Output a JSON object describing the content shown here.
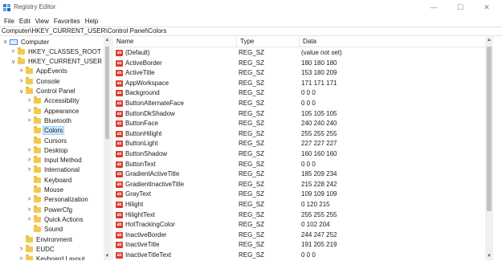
{
  "window": {
    "title": "Registry Editor",
    "min_glyph": "—",
    "max_glyph": "☐",
    "close_glyph": "✕"
  },
  "menu": [
    "File",
    "Edit",
    "View",
    "Favorites",
    "Help"
  ],
  "address": "Computer\\HKEY_CURRENT_USER\\Control Panel\\Colors",
  "tree": [
    {
      "label": "Computer",
      "level": 0,
      "chevron": "∨",
      "kind": "computer"
    },
    {
      "label": "HKEY_CLASSES_ROOT",
      "level": 1,
      "chevron": ">",
      "kind": "folder"
    },
    {
      "label": "HKEY_CURRENT_USER",
      "level": 1,
      "chevron": "∨",
      "kind": "folder"
    },
    {
      "label": "AppEvents",
      "level": 2,
      "chevron": ">",
      "kind": "folder"
    },
    {
      "label": "Console",
      "level": 2,
      "chevron": ">",
      "kind": "folder"
    },
    {
      "label": "Control Panel",
      "level": 2,
      "chevron": "∨",
      "kind": "folder"
    },
    {
      "label": "Accessibility",
      "level": 3,
      "chevron": ">",
      "kind": "folder"
    },
    {
      "label": "Appearance",
      "level": 3,
      "chevron": ">",
      "kind": "folder"
    },
    {
      "label": "Bluetooth",
      "level": 3,
      "chevron": ">",
      "kind": "folder"
    },
    {
      "label": "Colors",
      "level": 3,
      "chevron": "",
      "kind": "folder",
      "selected": true
    },
    {
      "label": "Cursors",
      "level": 3,
      "chevron": "",
      "kind": "folder"
    },
    {
      "label": "Desktop",
      "level": 3,
      "chevron": ">",
      "kind": "folder"
    },
    {
      "label": "Input Method",
      "level": 3,
      "chevron": ">",
      "kind": "folder"
    },
    {
      "label": "International",
      "level": 3,
      "chevron": ">",
      "kind": "folder"
    },
    {
      "label": "Keyboard",
      "level": 3,
      "chevron": "",
      "kind": "folder"
    },
    {
      "label": "Mouse",
      "level": 3,
      "chevron": "",
      "kind": "folder"
    },
    {
      "label": "Personalization",
      "level": 3,
      "chevron": ">",
      "kind": "folder"
    },
    {
      "label": "PowerCfg",
      "level": 3,
      "chevron": ">",
      "kind": "folder"
    },
    {
      "label": "Quick Actions",
      "level": 3,
      "chevron": ">",
      "kind": "folder"
    },
    {
      "label": "Sound",
      "level": 3,
      "chevron": "",
      "kind": "folder"
    },
    {
      "label": "Environment",
      "level": 2,
      "chevron": "",
      "kind": "folder"
    },
    {
      "label": "EUDC",
      "level": 2,
      "chevron": ">",
      "kind": "folder"
    },
    {
      "label": "Keyboard Layout",
      "level": 2,
      "chevron": ">",
      "kind": "folder"
    }
  ],
  "columns": {
    "name": "Name",
    "type": "Type",
    "data": "Data"
  },
  "values": [
    {
      "name": "(Default)",
      "type": "REG_SZ",
      "data": "(value not set)"
    },
    {
      "name": "ActiveBorder",
      "type": "REG_SZ",
      "data": "180 180 180"
    },
    {
      "name": "ActiveTitle",
      "type": "REG_SZ",
      "data": "153 180 209"
    },
    {
      "name": "AppWorkspace",
      "type": "REG_SZ",
      "data": "171 171 171"
    },
    {
      "name": "Background",
      "type": "REG_SZ",
      "data": "0 0 0"
    },
    {
      "name": "ButtonAlternateFace",
      "type": "REG_SZ",
      "data": "0 0 0"
    },
    {
      "name": "ButtonDkShadow",
      "type": "REG_SZ",
      "data": "105 105 105"
    },
    {
      "name": "ButtonFace",
      "type": "REG_SZ",
      "data": "240 240 240"
    },
    {
      "name": "ButtonHilight",
      "type": "REG_SZ",
      "data": "255 255 255"
    },
    {
      "name": "ButtonLight",
      "type": "REG_SZ",
      "data": "227 227 227"
    },
    {
      "name": "ButtonShadow",
      "type": "REG_SZ",
      "data": "160 160 160"
    },
    {
      "name": "ButtonText",
      "type": "REG_SZ",
      "data": "0 0 0"
    },
    {
      "name": "GradientActiveTitle",
      "type": "REG_SZ",
      "data": "185 209 234"
    },
    {
      "name": "GradientInactiveTitle",
      "type": "REG_SZ",
      "data": "215 228 242"
    },
    {
      "name": "GrayText",
      "type": "REG_SZ",
      "data": "109 109 109"
    },
    {
      "name": "Hilight",
      "type": "REG_SZ",
      "data": "0 120 215"
    },
    {
      "name": "HilightText",
      "type": "REG_SZ",
      "data": "255 255 255"
    },
    {
      "name": "HotTrackingColor",
      "type": "REG_SZ",
      "data": "0 102 204"
    },
    {
      "name": "InactiveBorder",
      "type": "REG_SZ",
      "data": "244 247 252"
    },
    {
      "name": "InactiveTitle",
      "type": "REG_SZ",
      "data": "191 205 219"
    },
    {
      "name": "InactiveTitleText",
      "type": "REG_SZ",
      "data": "0 0 0"
    }
  ],
  "value_icon_text": "ab",
  "scroll_arrows": {
    "up": "▲",
    "down": "▼"
  }
}
